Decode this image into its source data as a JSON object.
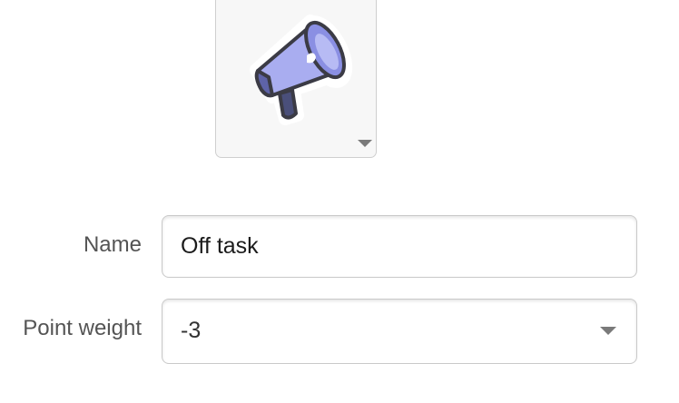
{
  "icon_picker": {
    "icon": "megaphone-icon",
    "colors": {
      "outline": "#3b3b45",
      "body": "#9fa3ee",
      "bell_inner": "#7f85dc",
      "handle": "#4a4f7a"
    }
  },
  "form": {
    "name_label": "Name",
    "name_value": "Off task",
    "weight_label": "Point weight",
    "weight_value": "-3"
  }
}
